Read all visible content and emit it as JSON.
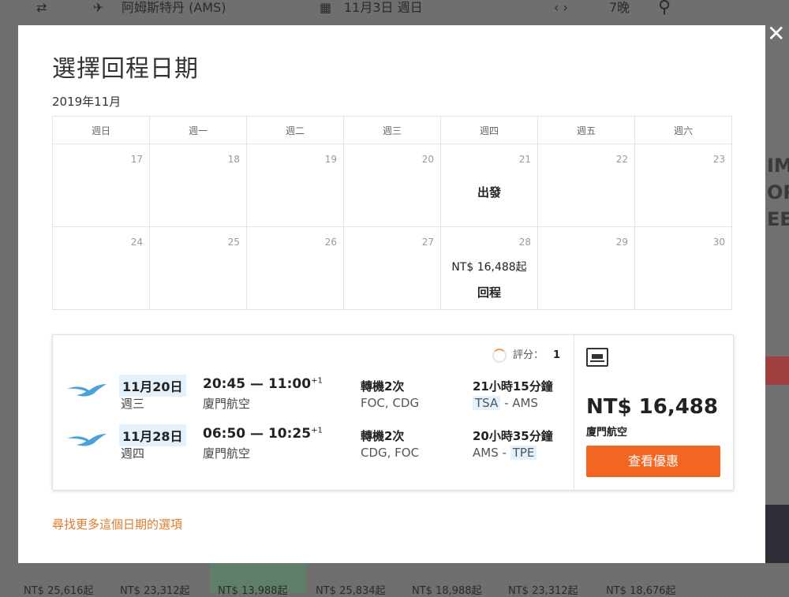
{
  "background": {
    "origin": "阿姆斯特丹 (AMS)",
    "date": "11月3日 週日",
    "nights": "7晚",
    "bottom_prices": [
      "NT$ 25,616起",
      "NT$ 23,312起",
      "NT$ 13,988起",
      "NT$ 25,834起",
      "NT$ 18,988起",
      "NT$ 23,312起",
      "NT$ 18,676起"
    ]
  },
  "modal": {
    "title": "選擇回程日期",
    "month": "2019年11月",
    "weekdays": [
      "週日",
      "週一",
      "週二",
      "週三",
      "週四",
      "週五",
      "週六"
    ],
    "week1": [
      "17",
      "18",
      "19",
      "20",
      "21",
      "22",
      "23"
    ],
    "week2": [
      "24",
      "25",
      "26",
      "27",
      "28",
      "29",
      "30"
    ],
    "depart_label": "出發",
    "return_label": "回程",
    "return_price": "NT$ 16,488起",
    "more_link": "尋找更多這個日期的選項"
  },
  "flight": {
    "rating_label": "評分：",
    "rating_value": "1",
    "legs": [
      {
        "date": "11月20日",
        "weekday": "週三",
        "times": "20:45 — 11:00",
        "plus": "+1",
        "airline": "廈門航空",
        "stops": "轉機2次",
        "via": "FOC, CDG",
        "duration": "21小時15分鐘",
        "from": "TSA",
        "to": "AMS"
      },
      {
        "date": "11月28日",
        "weekday": "週四",
        "times": "06:50 — 10:25",
        "plus": "+1",
        "airline": "廈門航空",
        "stops": "轉機2次",
        "via": "CDG, FOC",
        "duration": "20小時35分鐘",
        "from": "AMS",
        "to": "TPE"
      }
    ],
    "price": "NT$ 16,488",
    "price_airline": "廈門航空",
    "deal_button": "查看優惠"
  },
  "colors": {
    "accent": "#f26522",
    "highlight": "#e2f1fb",
    "link": "#e07a2c"
  }
}
